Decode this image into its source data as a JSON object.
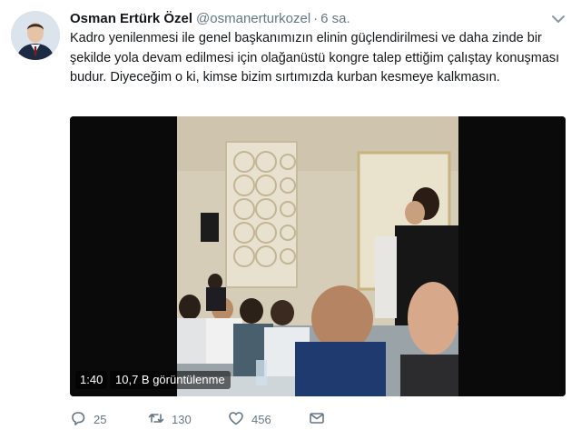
{
  "tweet": {
    "author_name": "Osman Ertürk Özel",
    "author_handle": "@osmanerturkozel",
    "separator": "·",
    "time": "6 sa.",
    "text": "Kadro yenilenmesi ile genel başkanımızın elinin güçlendirilmesi ve daha zinde bir şekilde yola devam edilmesi için olağanüstü kongre talep ettiğim çalıştay konuşması budur. Diyeceğim o ki, kimse bizim sırtımızda kurban kesmeye kalkmasın."
  },
  "video": {
    "duration": "1:40",
    "views": "10,7 B görüntülenme"
  },
  "actions": {
    "reply_count": "25",
    "retweet_count": "130",
    "like_count": "456"
  },
  "icons": {
    "reply": "reply-icon",
    "retweet": "retweet-icon",
    "like": "heart-icon",
    "dm": "envelope-icon",
    "more": "chevron-down-icon"
  },
  "colors": {
    "text": "#14171a",
    "secondary": "#657786"
  }
}
